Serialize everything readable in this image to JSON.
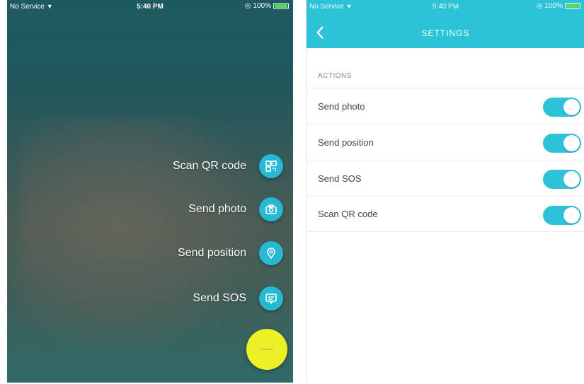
{
  "left_screen": {
    "status": {
      "carrier": "No Service",
      "time": "5:40 PM",
      "battery": "100%"
    },
    "actions": [
      {
        "label": "Scan QR code",
        "icon": "qr-code-icon"
      },
      {
        "label": "Send photo",
        "icon": "camera-icon"
      },
      {
        "label": "Send position",
        "icon": "location-pin-icon"
      },
      {
        "label": "Send SOS",
        "icon": "message-icon"
      }
    ],
    "main_button_icon": "minus-icon"
  },
  "right_screen": {
    "status": {
      "carrier": "No Service",
      "time": "5:40 PM",
      "battery": "100%"
    },
    "title": "SETTINGS",
    "back_icon": "chevron-left-icon",
    "section_header": "ACTIONS",
    "settings": [
      {
        "label": "Send photo",
        "enabled": true
      },
      {
        "label": "Send position",
        "enabled": true
      },
      {
        "label": "Send SOS",
        "enabled": true
      },
      {
        "label": "Scan QR code",
        "enabled": true
      }
    ]
  },
  "colors": {
    "accent": "#2cc3d9",
    "fab_main": "#eef026",
    "fab_mini": "#27b8d3"
  }
}
